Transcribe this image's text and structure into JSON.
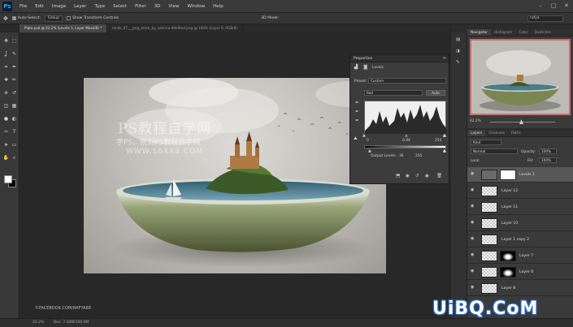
{
  "app": {
    "logo": "Ps"
  },
  "menu": [
    "File",
    "Edit",
    "Image",
    "Layer",
    "Type",
    "Select",
    "Filter",
    "3D",
    "View",
    "Window",
    "Help"
  ],
  "window_controls": [
    "–",
    "□",
    "✕"
  ],
  "options_bar": {
    "auto_select_label": "Auto-Select:",
    "auto_select_value": "Group",
    "transform_controls_label": "Show Transform Controls",
    "mode_3d_label": "3D Mode:",
    "workspace": "rafya"
  },
  "doc_tabs": [
    {
      "label": "Plate.psd @ 42.2% (Levels 1, Layer Mask/8) *",
      "active": true
    },
    {
      "label": "lands_07___png_stock_by_sebrina-d9ofbxd.png @ 100% (Layer 0, RGB/8)",
      "active": false
    }
  ],
  "tools": [
    "move-icon",
    "marquee-icon",
    "lasso-icon",
    "quick-select-icon",
    "crop-icon",
    "eyedropper-icon",
    "healing-icon",
    "brush-icon",
    "stamp-icon",
    "history-brush-icon",
    "eraser-icon",
    "gradient-icon",
    "blur-icon",
    "dodge-icon",
    "pen-icon",
    "type-icon",
    "path-select-icon",
    "shape-icon",
    "hand-icon",
    "zoom-icon"
  ],
  "tool_glyphs": [
    "✥",
    "⬚",
    "ʆ",
    "✎",
    "⌗",
    "✒",
    "✚",
    "✏",
    "⎈",
    "↺",
    "◫",
    "▦",
    "●",
    "◐",
    "✑",
    "T",
    "➤",
    "▭",
    "✋",
    "⌕"
  ],
  "canvas": {
    "watermark_title": "PS教程自学网",
    "watermark_sub": "学PS，就到PS教程自学网",
    "watermark_url": "WWW.16XX8.COM",
    "credit": "©FACEBOOK.COM/RAFYA88"
  },
  "properties": {
    "title": "Properties",
    "layer_type": "Levels",
    "preset_label": "Preset:",
    "preset_value": "Custom",
    "channel_value": "Red",
    "auto_button": "Auto",
    "input_black": "0",
    "input_mid": "0.94",
    "input_white": "255",
    "output_label": "Output Levels:",
    "output_black": "36",
    "output_white": "255"
  },
  "navigator": {
    "tabs": [
      "Navigator",
      "Histogram",
      "Color",
      "Swatches"
    ],
    "zoom": "42.2%"
  },
  "layers": {
    "tabs": [
      "Layers",
      "Channels",
      "Paths"
    ],
    "kind_label": "Kind",
    "blend_mode": "Normal",
    "opacity_label": "Opacity:",
    "opacity_value": "100%",
    "lock_label": "Lock:",
    "fill_label": "Fill:",
    "fill_value": "100%",
    "rows": [
      {
        "name": "Levels 1",
        "selected": true,
        "mask": true
      },
      {
        "name": "Layer 12",
        "selected": false,
        "mask": false
      },
      {
        "name": "Layer 11",
        "selected": false,
        "mask": false
      },
      {
        "name": "Layer 10",
        "selected": false,
        "mask": false
      },
      {
        "name": "Layer 1 copy 2",
        "selected": false,
        "mask": false
      },
      {
        "name": "Layer 7",
        "selected": false,
        "mask": true
      },
      {
        "name": "Layer 6",
        "selected": false,
        "mask": true
      },
      {
        "name": "Layer 8",
        "selected": false,
        "mask": false
      }
    ]
  },
  "status": {
    "zoom": "42.2%",
    "doc": "Doc: 7.44M/100.8M"
  },
  "site_watermark": "UiBQ.CoM"
}
